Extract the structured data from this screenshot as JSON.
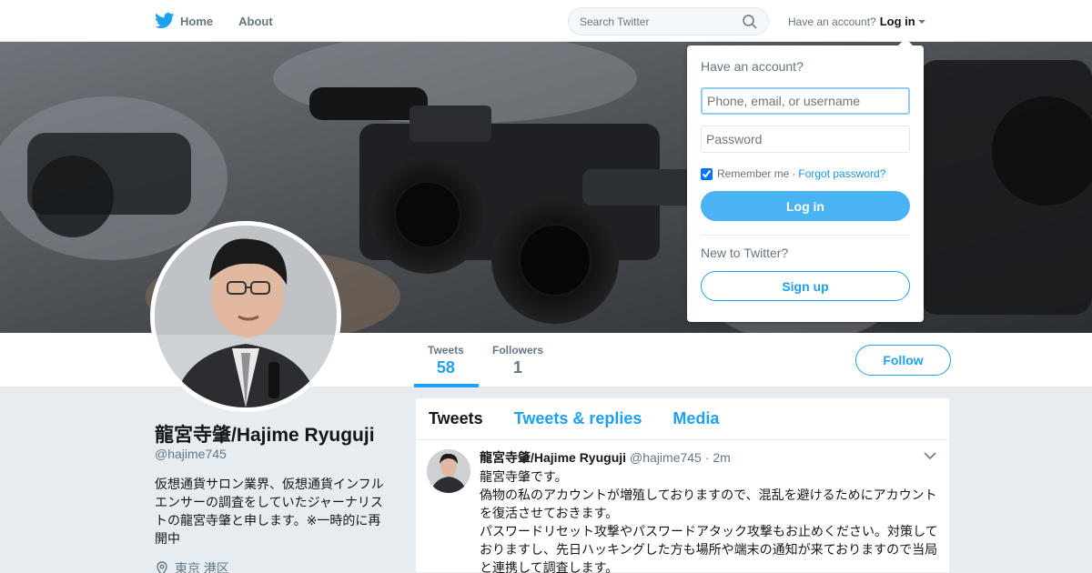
{
  "nav": {
    "home_label": "Home",
    "about_label": "About",
    "search_placeholder": "Search Twitter",
    "have_account": "Have an account?",
    "login_label": "Log in"
  },
  "login_dropdown": {
    "title": "Have an account?",
    "username_placeholder": "Phone, email, or username",
    "password_placeholder": "Password",
    "remember_me": "Remember me",
    "separator": "·",
    "forgot_password": "Forgot password?",
    "login_button": "Log in",
    "new_to_twitter": "New to Twitter?",
    "signup_button": "Sign up"
  },
  "profile_nav": {
    "tweets_label": "Tweets",
    "tweets_count": "58",
    "followers_label": "Followers",
    "followers_count": "1",
    "follow_button": "Follow"
  },
  "profile": {
    "name": "龍宮寺肇/Hajime Ryuguji",
    "handle": "@hajime745",
    "bio": "仮想通貨サロン業界、仮想通貨インフルエンサーの調査をしていたジャーナリストの龍宮寺肇と申します。※一時的に再開中",
    "location": "東京 港区"
  },
  "timeline": {
    "tabs": [
      "Tweets",
      "Tweets & replies",
      "Media"
    ],
    "tweet": {
      "name": "龍宮寺肇/Hajime Ryuguji",
      "handle": "@hajime745",
      "time": "· 2m",
      "text": "龍宮寺肇です。\n偽物の私のアカウントが増殖しておりますので、混乱を避けるためにアカウントを復活させておきます。\nパスワードリセット攻撃やパスワードアタック攻撃もお止めください。対策しておりますし、先日ハッキングした方も場所や端末の通知が来ておりますので当局と連携して調査します。"
    }
  },
  "colors": {
    "brand_blue": "#1da1f2",
    "background": "#e6ecf0"
  }
}
